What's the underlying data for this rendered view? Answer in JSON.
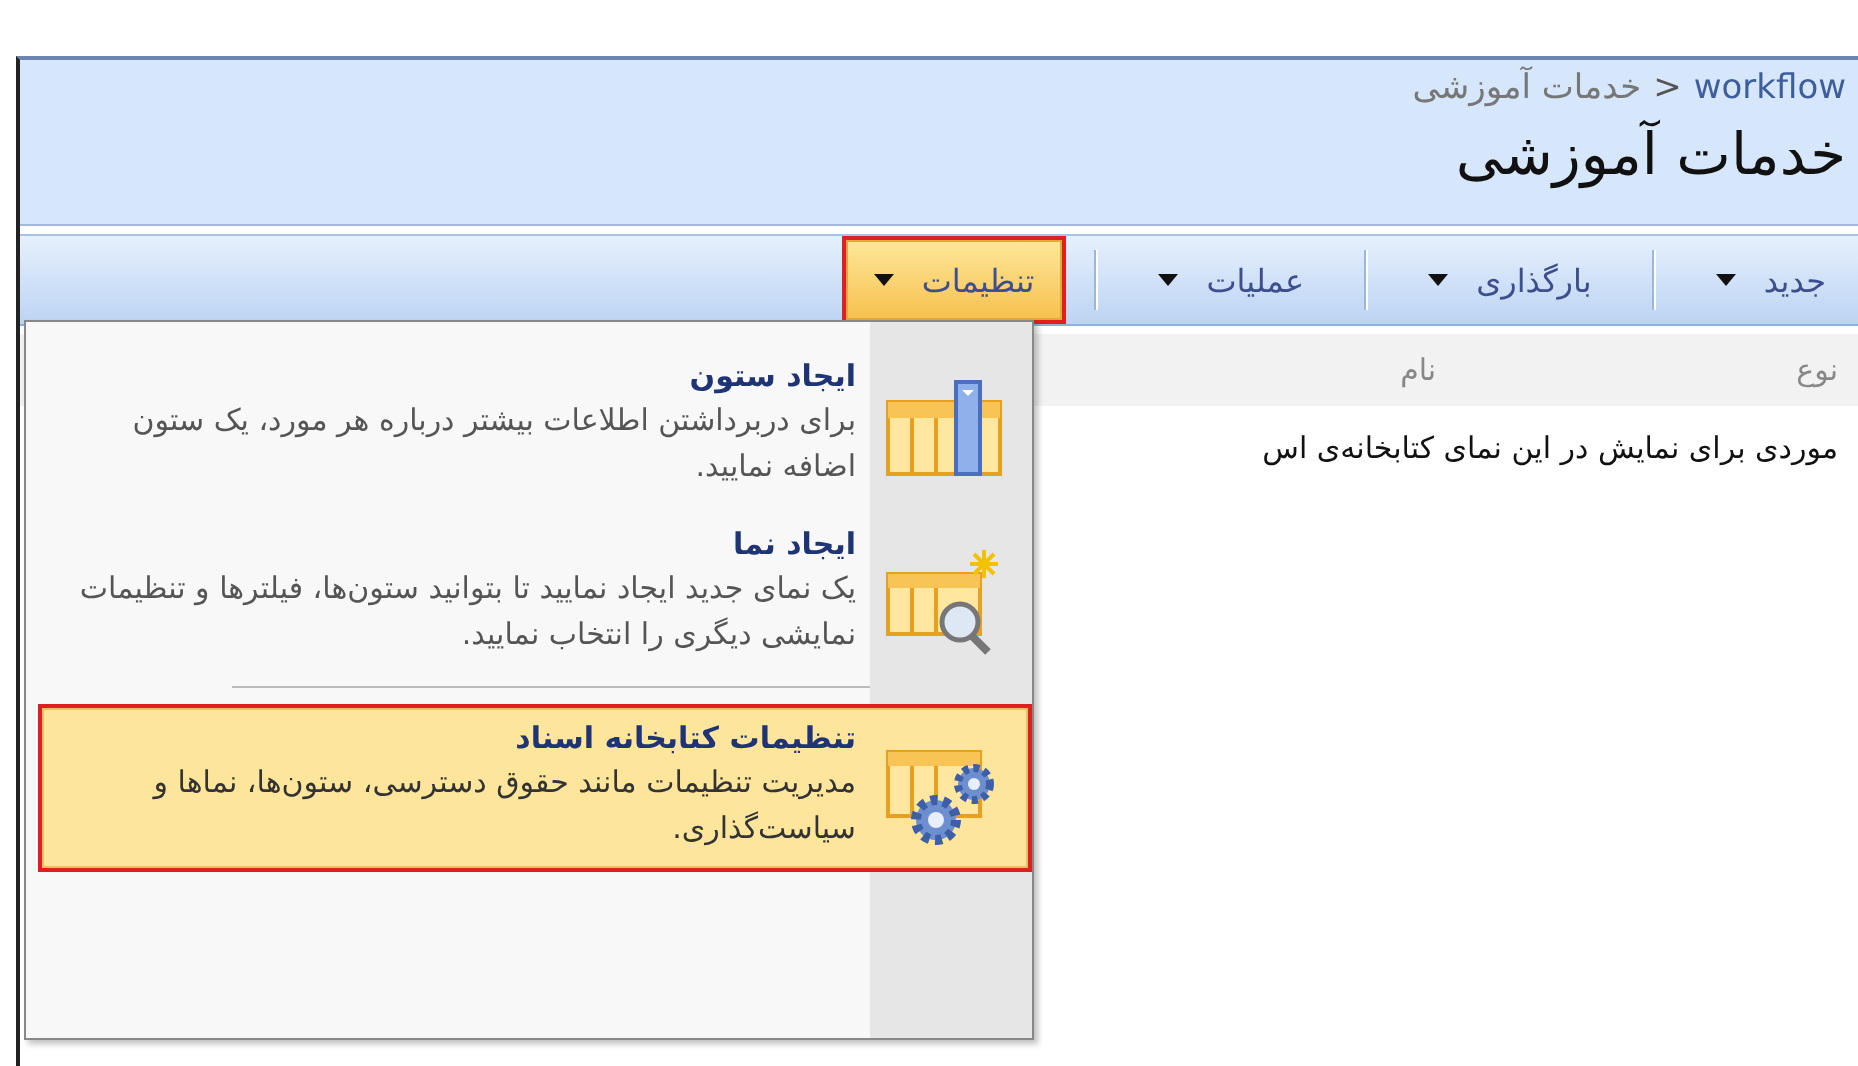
{
  "breadcrumb": [
    {
      "label": "workflow",
      "kind": "link"
    },
    {
      "label": ">",
      "kind": "separator"
    },
    {
      "label": "خدمات آموزشی",
      "kind": "current"
    }
  ],
  "title": "خدمات آموزشی",
  "toolbar": [
    {
      "label": "جدید",
      "open": false,
      "highlighted": false
    },
    {
      "label": "بارگذاری",
      "open": false,
      "highlighted": false
    },
    {
      "label": "عملیات",
      "open": false,
      "highlighted": false
    },
    {
      "label": "تنظیمات",
      "open": true,
      "highlighted": true
    }
  ],
  "table": {
    "columns": [
      "نوع",
      "نام"
    ],
    "empty_message": "موردی برای نمایش در این نمای کتابخانه‌ی اس"
  },
  "menu": {
    "items": [
      {
        "kind": "column",
        "title": "ایجاد ستون",
        "description": "برای دربرداشتن اطلاعات بیشتر درباره هر مورد، یک ستون اضافه نمایید.",
        "selected": false,
        "highlighted": false
      },
      {
        "kind": "view",
        "title": "ایجاد نما",
        "description": "یک نمای جدید ایجاد نمایید تا بتوانید ستون‌ها، فیلترها و تنظیمات نمایشی دیگری را انتخاب نمایید.",
        "selected": false,
        "highlighted": false
      },
      {
        "kind": "settings",
        "title": "تنظیمات کتابخانه اسناد",
        "description": "مدیریت تنظیمات مانند حقوق دسترسی، ستون‌ها، نماها و سیاست‌گذاری.",
        "selected": true,
        "highlighted": true
      }
    ]
  }
}
